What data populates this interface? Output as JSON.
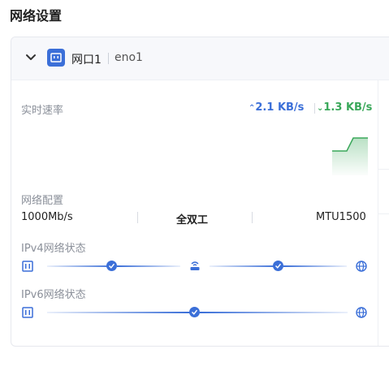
{
  "page": {
    "title": "网络设置"
  },
  "port": {
    "name": "网口1",
    "device": "eno1"
  },
  "rate": {
    "label": "实时速率",
    "upload": "2.1 KB/s",
    "download": "1.3 KB/s"
  },
  "config": {
    "label": "网络配置",
    "speed": "1000Mb/s",
    "duplex": "全双工",
    "mtu": "MTU1500"
  },
  "ipv4": {
    "label": "IPv4网络状态"
  },
  "ipv6": {
    "label": "IPv6网络状态"
  },
  "colors": {
    "accent": "#3b6fd8",
    "download": "#3aa85a"
  }
}
